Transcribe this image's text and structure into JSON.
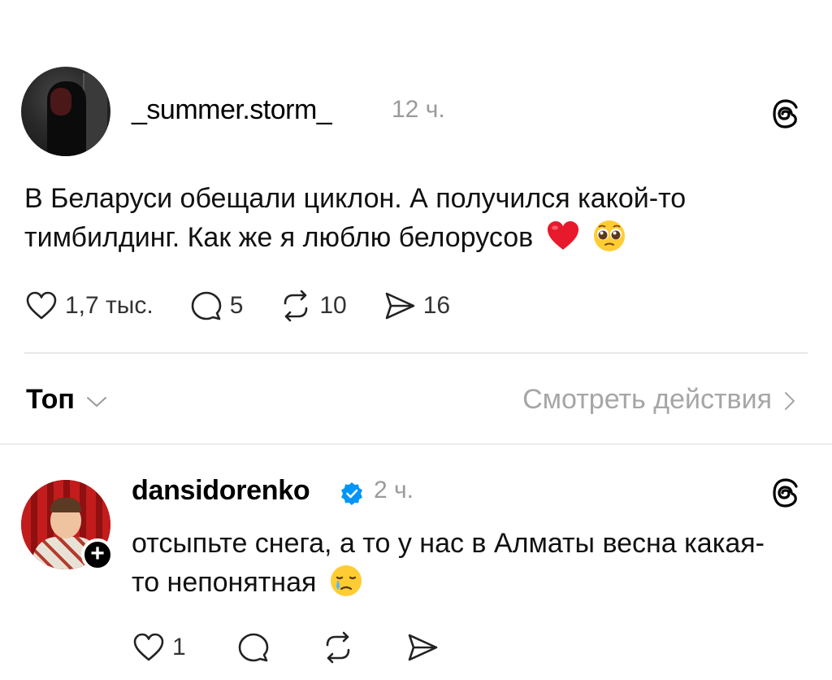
{
  "post": {
    "username": "_summer.storm_",
    "time": "12 ч.",
    "text": "В Беларуси обещали циклон. А получился какой-то тимбилдинг. Как же я люблю белорусов",
    "emojis": [
      "red-heart-emoji",
      "pleading-face-emoji"
    ],
    "likes": "1,7 тыс.",
    "comments": "5",
    "reposts": "10",
    "shares": "16"
  },
  "sort": {
    "label": "Топ",
    "view_activity": "Смотреть действия"
  },
  "reply": {
    "username": "dansidorenko",
    "verified": true,
    "time": "2 ч.",
    "text": "отсыпьте снега, а то у нас в Алматы весна какая-то непонятная",
    "emojis": [
      "crying-face-emoji"
    ],
    "likes": "1"
  },
  "colors": {
    "text": "#000000",
    "muted": "#9a9a9a",
    "verified": "#0095f6",
    "heart": "#e8192c"
  }
}
